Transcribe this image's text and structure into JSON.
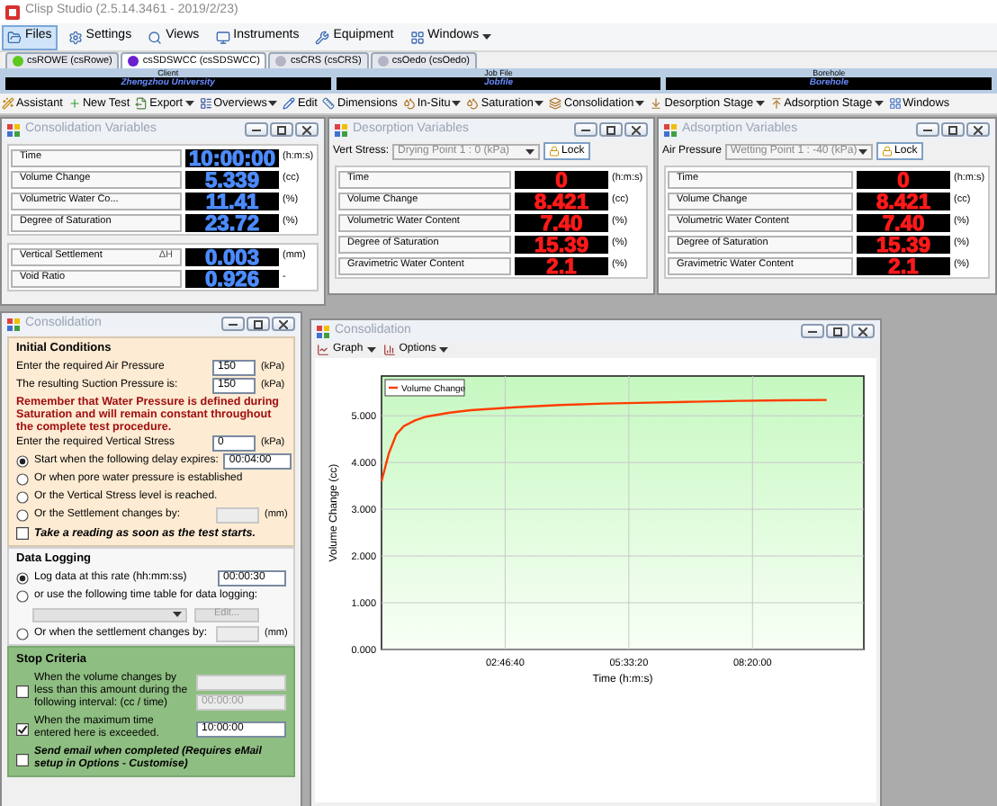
{
  "window": {
    "title": "Clisp Studio (2.5.14.3461 - 2019/2/23)"
  },
  "menu": [
    {
      "label": "Files",
      "selected": true
    },
    {
      "label": "Settings",
      "selected": false
    },
    {
      "label": "Views",
      "selected": false
    },
    {
      "label": "Instruments",
      "selected": false
    },
    {
      "label": "Equipment",
      "selected": false
    },
    {
      "label": "Windows",
      "selected": false,
      "dropdown": true
    }
  ],
  "tabs": [
    {
      "label": "csROWE (csRowe)",
      "selected": false,
      "color": "#5ec81e"
    },
    {
      "label": "csSDSWCC (csSDSWCC)",
      "selected": true,
      "color": "#6a1fd0"
    },
    {
      "label": "csCRS (csCRS)",
      "selected": false,
      "color": "#b4b4c4"
    },
    {
      "label": "csOedo (csOedo)",
      "selected": false,
      "color": "#b4b4c4"
    }
  ],
  "info_bar": [
    {
      "header": "Client",
      "value": "Zhengzhou University"
    },
    {
      "header": "Job File",
      "value": "Jobfile"
    },
    {
      "header": "Borehole",
      "value": "Borehole"
    }
  ],
  "toolbar": [
    {
      "label": "Assistant",
      "dropdown": false
    },
    {
      "label": "New Test",
      "dropdown": false
    },
    {
      "label": "Export",
      "dropdown": true
    },
    {
      "label": "Overviews",
      "dropdown": true
    },
    {
      "label": "Edit",
      "dropdown": false
    },
    {
      "label": "Dimensions",
      "dropdown": false
    },
    {
      "label": "In-Situ",
      "dropdown": true
    },
    {
      "label": "Saturation",
      "dropdown": true
    },
    {
      "label": "Consolidation",
      "dropdown": true
    },
    {
      "label": "Desorption Stage",
      "dropdown": true
    },
    {
      "label": "Adsorption Stage",
      "dropdown": true
    },
    {
      "label": "Windows",
      "dropdown": false
    }
  ],
  "variable_windows": [
    {
      "title": "Consolidation Variables",
      "kind": "live",
      "groups": [
        [
          {
            "label": "Time",
            "value": "10:00:00",
            "unit": "(h:m:s)"
          },
          {
            "label": "Volume Change",
            "value": "5.339",
            "unit": "(cc)"
          },
          {
            "label": "Volumetric Water Co...",
            "value": "11.41",
            "unit": "(%)"
          },
          {
            "label": "Degree of Saturation",
            "value": "23.72",
            "unit": "(%)"
          }
        ],
        [
          {
            "label": "Vertical Settlement",
            "marker": "ΔH",
            "value": "0.003",
            "unit": "(mm)"
          },
          {
            "label": "Void Ratio",
            "value": "0.926",
            "unit": "-"
          }
        ]
      ]
    },
    {
      "title": "Desorption Variables",
      "kind": "stage",
      "selector": {
        "label": "Vert Stress:",
        "value": "Drying Point 1 : 0 (kPa)"
      },
      "lock": "Lock",
      "groups": [
        [
          {
            "label": "Time",
            "value": "0",
            "unit": "(h:m:s)"
          },
          {
            "label": "Volume Change",
            "value": "8.421",
            "unit": "(cc)"
          },
          {
            "label": "Volumetric Water Content",
            "value": "7.40",
            "unit": "(%)"
          },
          {
            "label": "Degree of Saturation",
            "value": "15.39",
            "unit": "(%)"
          },
          {
            "label": "Gravimetric Water Content",
            "value": "2.1",
            "unit": "(%)"
          }
        ]
      ]
    },
    {
      "title": "Adsorption Variables",
      "kind": "stage",
      "selector": {
        "label": "Air Pressure",
        "value": "Wetting Point 1 : -40 (kPa)"
      },
      "lock": "Lock",
      "groups": [
        [
          {
            "label": "Time",
            "value": "0",
            "unit": "(h:m:s)"
          },
          {
            "label": "Volume Change",
            "value": "8.421",
            "unit": "(cc)"
          },
          {
            "label": "Volumetric Water Content",
            "value": "7.40",
            "unit": "(%)"
          },
          {
            "label": "Degree of Saturation",
            "value": "15.39",
            "unit": "(%)"
          },
          {
            "label": "Gravimetric Water Content",
            "value": "2.1",
            "unit": "(%)"
          }
        ]
      ]
    }
  ],
  "consolidation": {
    "title": "Consolidation",
    "initial_conditions": {
      "title": "Initial Conditions",
      "air_pressure": {
        "label": "Enter the required Air Pressure",
        "value": "150",
        "unit": "(kPa)"
      },
      "suction_pressure": {
        "label": "The resulting Suction Pressure is:",
        "value": "150",
        "unit": "(kPa)"
      },
      "warning": "Remember that Water Pressure is defined during Saturation and will remain constant throughout the complete test procedure.",
      "vertical_stress": {
        "label": "Enter the required Vertical Stress",
        "value": "0",
        "unit": "(kPa)"
      },
      "options": [
        {
          "label": "Start when the following delay expires:",
          "selected": true,
          "value": "00:04:00"
        },
        {
          "label": "Or when pore water pressure is established",
          "selected": false
        },
        {
          "label": "Or the Vertical Stress level is reached.",
          "selected": false
        },
        {
          "label": "Or the Settlement changes by:",
          "selected": false,
          "unit": "(mm)",
          "field": true
        }
      ],
      "reading": {
        "label": "Take a reading as soon as the test starts.",
        "checked": false
      }
    },
    "data_logging": {
      "title": "Data Logging",
      "options": [
        {
          "label": "Log data at this rate (hh:mm:ss)",
          "selected": true,
          "value": "00:00:30"
        },
        {
          "label": "or use the following time table for data logging:",
          "selected": false,
          "table": true
        },
        {
          "label": "Or when the settlement changes by:",
          "selected": false,
          "unit": "(mm)",
          "field": true
        }
      ],
      "edit": "Edit..."
    },
    "stop_criteria": {
      "title": "Stop Criteria",
      "items": [
        {
          "label": "When the volume changes by less than this amount during the following interval:  (cc / time)",
          "checked": false,
          "value": "00:00:00",
          "field": true
        },
        {
          "label": "When the maximum time entered here is exceeded.",
          "checked": true,
          "value": "10:00:00"
        },
        {
          "label": "Send email when completed (Requires eMail setup in Options - Customise)",
          "checked": false,
          "kind": "emphasis"
        }
      ]
    }
  },
  "graph_window": {
    "title": "Consolidation",
    "menu": [
      {
        "label": "Graph"
      },
      {
        "label": "Options"
      }
    ],
    "chart_data": {
      "type": "line",
      "xlabel": "Time (h:m:s)",
      "ylabel": "Volume Change (cc)",
      "xlim": [
        0,
        39000
      ],
      "ylim": [
        0,
        5.85
      ],
      "xticks": [
        {
          "value": 10000,
          "label": "02:46:40"
        },
        {
          "value": 20000,
          "label": "05:33:20"
        },
        {
          "value": 30000,
          "label": "08:20:00"
        }
      ],
      "grid": true,
      "yticks": [
        {
          "value": 0,
          "label": "0.000"
        },
        {
          "value": 1,
          "label": "1.000"
        },
        {
          "value": 2,
          "label": "2.000"
        },
        {
          "value": 3,
          "label": "3.000"
        },
        {
          "value": 4,
          "label": "4.000"
        },
        {
          "value": 5,
          "label": "5.000"
        }
      ],
      "x": [
        0,
        600,
        1200,
        1800,
        2700,
        3600,
        5400,
        7200,
        10800,
        14400,
        18000,
        21600,
        25200,
        28800,
        32400,
        36000
      ],
      "series": [
        {
          "name": "Volume Change",
          "color": "#ff3c00",
          "values": [
            3.6,
            4.2,
            4.6,
            4.78,
            4.9,
            4.98,
            5.06,
            5.12,
            5.18,
            5.23,
            5.26,
            5.28,
            5.3,
            5.32,
            5.33,
            5.34
          ]
        }
      ]
    }
  }
}
